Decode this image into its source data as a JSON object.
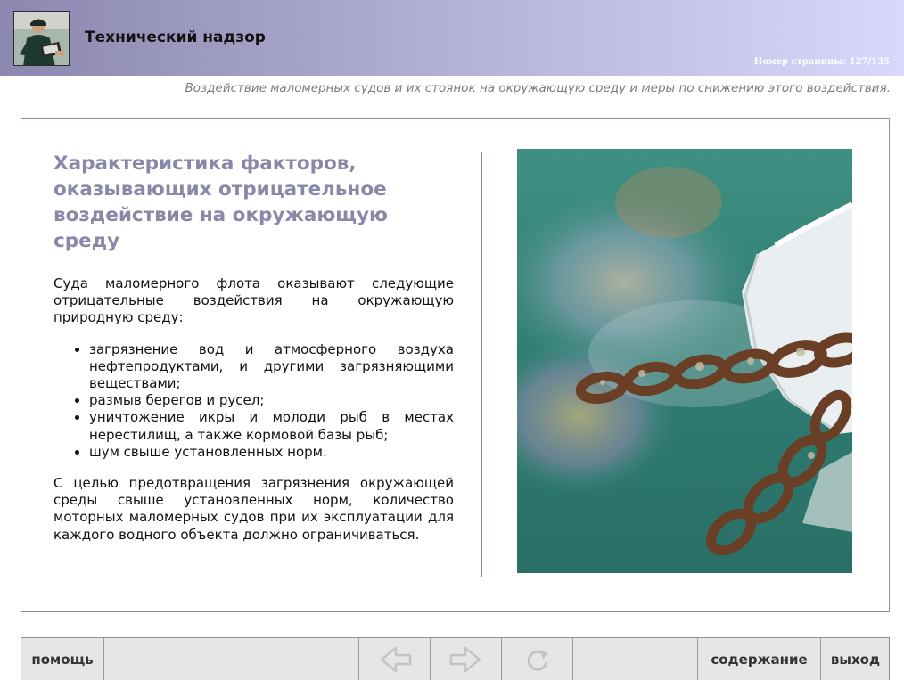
{
  "header": {
    "title": "Технический надзор",
    "page_number": "Номер страницы: 127/135",
    "subtitle": "Воздействие маломерных судов и их стоянок на окружающую среду и меры по снижению этого воздействия."
  },
  "slide": {
    "heading": "Характеристика факторов, оказывающих отрицательное воздействие на окружающую среду",
    "intro": "Суда маломерного флота оказывают следующие отрицательные воздействия на окружающую природную среду:",
    "bullets": [
      "загрязнение вод и атмосферного воздуха нефтепродуктами, и другими загрязняющими веществами;",
      "размыв берегов и русел;",
      "уничтожение икры и молоди рыб в местах нерестилищ, а также кормовой базы рыб;",
      "шум свыше установленных норм."
    ],
    "conclusion": "С целью предотвращения загрязнения окружающей среды свыше установленных норм, количество моторных маломерных судов при их эксплуатации для каждого водного объекта должно ограничиваться."
  },
  "nav": {
    "help": "помощь",
    "contents": "содержание",
    "exit": "выход"
  },
  "icons": {
    "back": "arrow-left-icon",
    "forward": "arrow-right-icon",
    "reload": "reload-icon"
  },
  "colors": {
    "heading": "#8a88a8",
    "frame_border": "#8e8cb3",
    "header_gradient_start": "#8b87ae",
    "header_gradient_end": "#d9d8fc"
  }
}
